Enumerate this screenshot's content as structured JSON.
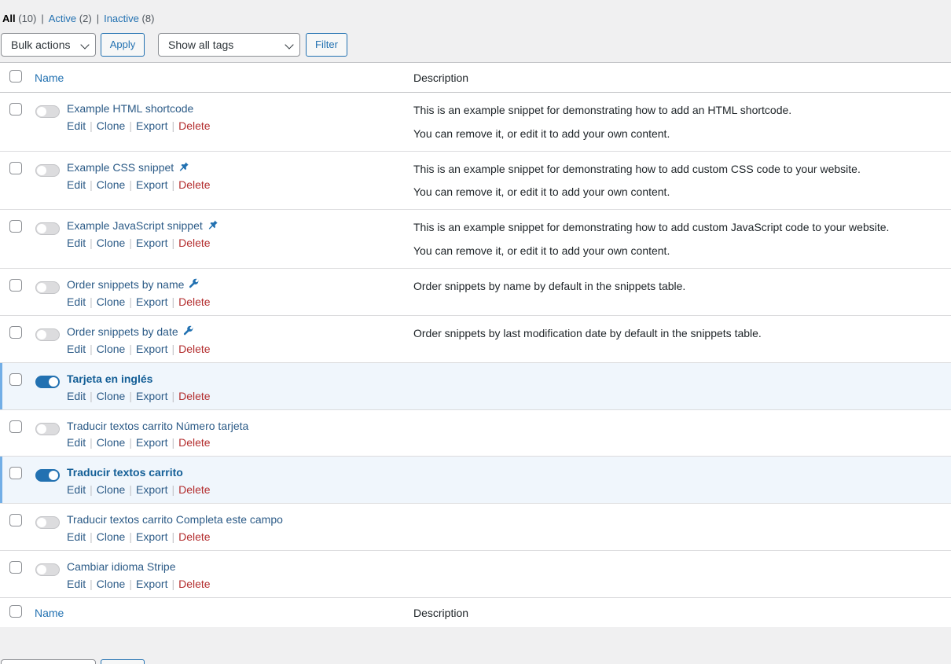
{
  "filters": {
    "all_label": "All",
    "all_count": "(10)",
    "active_label": "Active",
    "active_count": "(2)",
    "inactive_label": "Inactive",
    "inactive_count": "(8)",
    "separator": "|"
  },
  "toolbar": {
    "bulk_actions": "Bulk actions",
    "apply": "Apply",
    "tags": "Show all tags",
    "filter": "Filter"
  },
  "table": {
    "col_name": "Name",
    "col_description": "Description"
  },
  "actions": {
    "edit": "Edit",
    "clone": "Clone",
    "export": "Export",
    "delete": "Delete"
  },
  "snippets": [
    {
      "title": "Example HTML shortcode",
      "active": false,
      "icon": "",
      "desc": [
        "This is an example snippet for demonstrating how to add an HTML shortcode.",
        "You can remove it, or edit it to add your own content."
      ]
    },
    {
      "title": "Example CSS snippet",
      "active": false,
      "icon": "pin-icon",
      "desc": [
        "This is an example snippet for demonstrating how to add custom CSS code to your website.",
        "You can remove it, or edit it to add your own content."
      ]
    },
    {
      "title": "Example JavaScript snippet",
      "active": false,
      "icon": "pin-icon",
      "desc": [
        "This is an example snippet for demonstrating how to add custom JavaScript code to your website.",
        "You can remove it, or edit it to add your own content."
      ]
    },
    {
      "title": "Order snippets by name",
      "active": false,
      "icon": "wrench-icon",
      "desc": [
        "Order snippets by name by default in the snippets table."
      ]
    },
    {
      "title": "Order snippets by date",
      "active": false,
      "icon": "wrench-icon",
      "desc": [
        "Order snippets by last modification date by default in the snippets table."
      ]
    },
    {
      "title": "Tarjeta en inglés",
      "active": true,
      "icon": "",
      "desc": []
    },
    {
      "title": "Traducir textos carrito Número tarjeta",
      "active": false,
      "icon": "",
      "desc": []
    },
    {
      "title": "Traducir textos carrito",
      "active": true,
      "icon": "",
      "desc": []
    },
    {
      "title": "Traducir textos carrito Completa este campo",
      "active": false,
      "icon": "",
      "desc": []
    },
    {
      "title": "Cambiar idioma Stripe",
      "active": false,
      "icon": "",
      "desc": []
    }
  ],
  "colors": {
    "accent": "#2271b1",
    "delete": "#b32d2e",
    "active_row": "#f0f6fc"
  }
}
